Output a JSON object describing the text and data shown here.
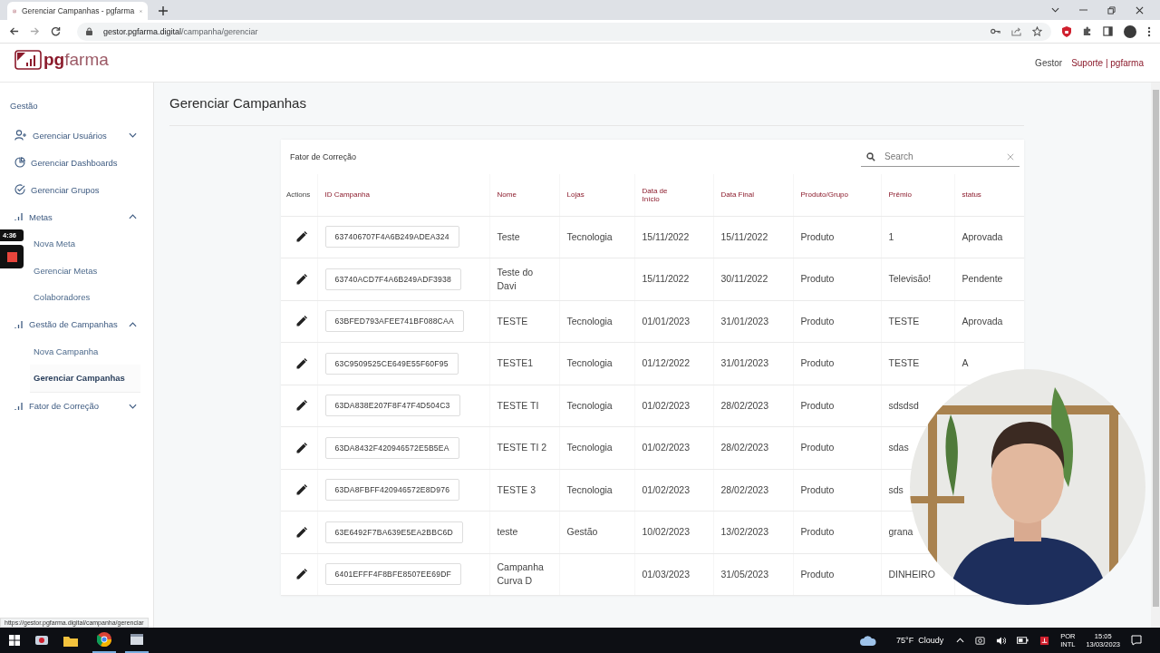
{
  "browser": {
    "tab_title": "Gerenciar Campanhas - pgfarma",
    "url_domain": "gestor.pgfarma.digital",
    "url_path": "/campanha/gerenciar"
  },
  "header": {
    "logo": "**pg**farma",
    "user": "Gestor",
    "support_link": "Suporte | pgfarma"
  },
  "sidebar": {
    "section": "Gestão",
    "items": [
      {
        "label": "Gerenciar Usuários",
        "kind": "group",
        "expanded": false
      },
      {
        "label": "Gerenciar Dashboards",
        "kind": "link"
      },
      {
        "label": "Gerenciar Grupos",
        "kind": "link"
      },
      {
        "label": "Metas",
        "kind": "group",
        "expanded": true,
        "children": [
          {
            "label": "Nova Meta",
            "selected": false
          },
          {
            "label": "Gerenciar Metas",
            "selected": false
          },
          {
            "label": "Colaboradores",
            "selected": false
          }
        ]
      },
      {
        "label": "Gestão de Campanhas",
        "kind": "group",
        "expanded": true,
        "children": [
          {
            "label": "Nova Campanha",
            "selected": false
          },
          {
            "label": "Gerenciar Campanhas",
            "selected": true
          }
        ]
      },
      {
        "label": "Fator de Correção",
        "kind": "group",
        "expanded": false
      }
    ]
  },
  "recorder": {
    "time": "4:36"
  },
  "page_title": "Gerenciar Campanhas",
  "card": {
    "title": "Fator de Correção",
    "search": {
      "placeholder": "Search"
    },
    "table": {
      "columns": [
        "Actions",
        "ID Campanha",
        "Nome",
        "Lojas",
        "Data de Início",
        "Data Final",
        "Produto/Grupo",
        "Prêmio",
        "status"
      ],
      "rows": [
        {
          "id": "637406707F4A6B249ADEA324",
          "nome": "Teste",
          "lojas": "Tecnologia",
          "inicio": "15/11/2022",
          "final": "15/11/2022",
          "produto": "Produto",
          "premio": "1",
          "status": "Aprovada"
        },
        {
          "id": "63740ACD7F4A6B249ADF3938",
          "nome": "Teste do Davi",
          "inicio": "15/11/2022",
          "final": "30/11/2022",
          "produto": "Produto",
          "premio": "Televisão!",
          "status": "Pendente"
        },
        {
          "id": "63BFED793AFEE741BF088CAA",
          "nome": "TESTE",
          "lojas": "Tecnologia",
          "inicio": "01/01/2023",
          "final": "31/01/2023",
          "produto": "Produto",
          "premio": "TESTE",
          "status": "Aprovada"
        },
        {
          "id": "63C9509525CE649E55F60F95",
          "nome": "TESTE1",
          "lojas": "Tecnologia",
          "inicio": "01/12/2022",
          "final": "31/01/2023",
          "produto": "Produto",
          "premio": "TESTE",
          "status": "A"
        },
        {
          "id": "63DA838E207F8F47F4D504C3",
          "nome": "TESTE TI",
          "lojas": "Tecnologia",
          "inicio": "01/02/2023",
          "final": "28/02/2023",
          "produto": "Produto",
          "premio": "sdsdsd"
        },
        {
          "id": "63DA8432F420946572E5B5EA",
          "nome": "TESTE TI 2",
          "lojas": "Tecnologia",
          "inicio": "01/02/2023",
          "final": "28/02/2023",
          "produto": "Produto",
          "premio": "sdas"
        },
        {
          "id": "63DA8FBFF420946572E8D976",
          "nome": "TESTE 3",
          "lojas": "Tecnologia",
          "inicio": "01/02/2023",
          "final": "28/02/2023",
          "produto": "Produto",
          "premio": "sds"
        },
        {
          "id": "63E6492F7BA639E5EA2BBC6D",
          "nome": "teste",
          "lojas": "Gestão",
          "inicio": "10/02/2023",
          "final": "13/02/2023",
          "produto": "Produto",
          "premio": "grana"
        },
        {
          "id": "6401EFFF4F8BFE8507EE69DF",
          "nome": "Campanha Curva D",
          "inicio": "01/03/2023",
          "final": "31/05/2023",
          "produto": "Produto",
          "premio": "DINHEIRO"
        }
      ]
    }
  },
  "status_url": "https://gestor.pgfarma.digital/campanha/gerenciar",
  "taskbar": {
    "weather": "75°F  Cloudy",
    "language": [
      "POR",
      "INTL"
    ],
    "time": "15:05",
    "date": "13/03/2023"
  }
}
